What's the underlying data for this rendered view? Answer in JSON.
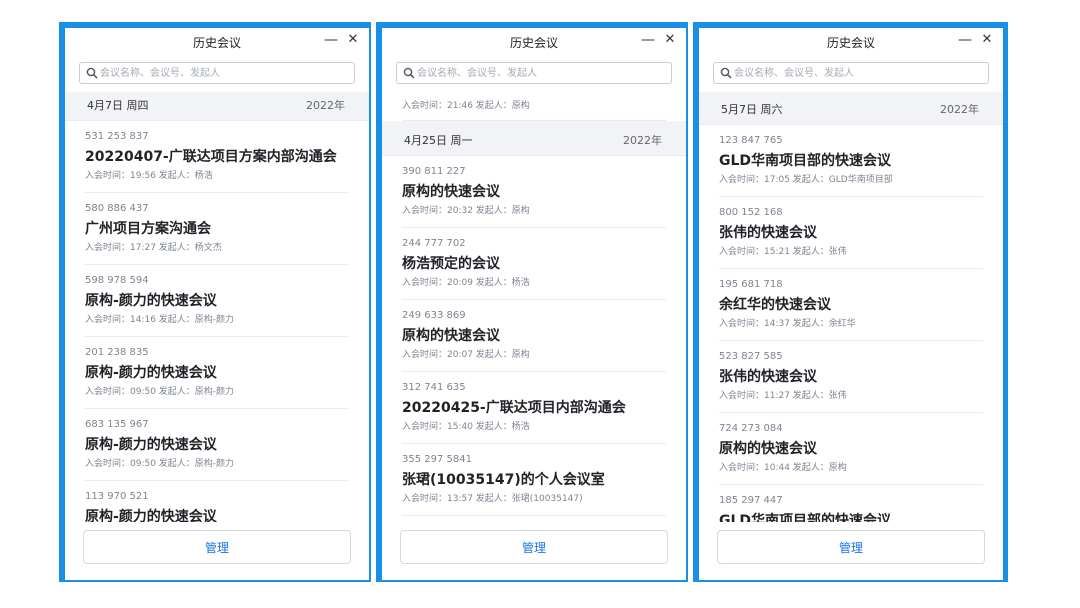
{
  "colors": {
    "frame": "#1a8fe6",
    "accent": "#1a73e8"
  },
  "panels": [
    {
      "title": "历史会议",
      "minimize": "—",
      "close": "✕",
      "search_placeholder": "会议名称、会议号、发起人",
      "manage": "管理",
      "groups": [
        {
          "date": "4月7日 周四",
          "year": "2022年",
          "meetings": [
            {
              "id": "531 253 837",
              "name": "20220407-广联达项目方案内部沟通会",
              "meta": "入会时间：19:56  发起人：杨浩"
            },
            {
              "id": "580 886 437",
              "name": "广州项目方案沟通会",
              "meta": "入会时间：17:27  发起人：杨文杰"
            },
            {
              "id": "598 978 594",
              "name": "原构-颜力的快速会议",
              "meta": "入会时间：14:16  发起人：原构-颜力"
            },
            {
              "id": "201 238 835",
              "name": "原构-颜力的快速会议",
              "meta": "入会时间：09:50  发起人：原构-颜力"
            },
            {
              "id": "683 135 967",
              "name": "原构-颜力的快速会议",
              "meta": "入会时间：09:50  发起人：原构-颜力"
            },
            {
              "id": "113 970 521",
              "name": "原构-颜力的快速会议",
              "meta": ""
            }
          ]
        }
      ]
    },
    {
      "title": "历史会议",
      "minimize": "—",
      "close": "✕",
      "search_placeholder": "会议名称、会议号、发起人",
      "manage": "管理",
      "lead_meta": "入会时间：21:46  发起人：原构",
      "groups": [
        {
          "date": "4月25日 周一",
          "year": "2022年",
          "meetings": [
            {
              "id": "390 811 227",
              "name": "原构的快速会议",
              "meta": "入会时间：20:32  发起人：原构"
            },
            {
              "id": "244 777 702",
              "name": "杨浩预定的会议",
              "meta": "入会时间：20:09  发起人：杨浩"
            },
            {
              "id": "249 633 869",
              "name": "原构的快速会议",
              "meta": "入会时间：20:07  发起人：原构"
            },
            {
              "id": "312 741 635",
              "name": "20220425-广联达项目内部沟通会",
              "meta": "入会时间：15:40  发起人：杨浩"
            },
            {
              "id": "355 297 5841",
              "name": "张珺(10035147)的个人会议室",
              "meta": "入会时间：13:57  发起人：张珺(10035147)"
            }
          ]
        }
      ]
    },
    {
      "title": "历史会议",
      "minimize": "—",
      "close": "✕",
      "search_placeholder": "会议名称、会议号、发起人",
      "manage": "管理",
      "groups": [
        {
          "date": "5月7日 周六",
          "year": "2022年",
          "meetings": [
            {
              "id": "123 847 765",
              "name": "GLD华南项目部的快速会议",
              "meta": "入会时间：17:05  发起人：GLD华南项目部"
            },
            {
              "id": "800 152 168",
              "name": "张伟的快速会议",
              "meta": "入会时间：15:21  发起人：张伟"
            },
            {
              "id": "195 681 718",
              "name": "余红华的快速会议",
              "meta": "入会时间：14:37  发起人：余红华"
            },
            {
              "id": "523 827 585",
              "name": "张伟的快速会议",
              "meta": "入会时间：11:27  发起人：张伟"
            },
            {
              "id": "724 273 084",
              "name": "原构的快速会议",
              "meta": "入会时间：10:44  发起人：原构"
            },
            {
              "id": "185 297 447",
              "name": "GLD华南项目部的快速会议",
              "meta": ""
            }
          ]
        }
      ]
    }
  ]
}
